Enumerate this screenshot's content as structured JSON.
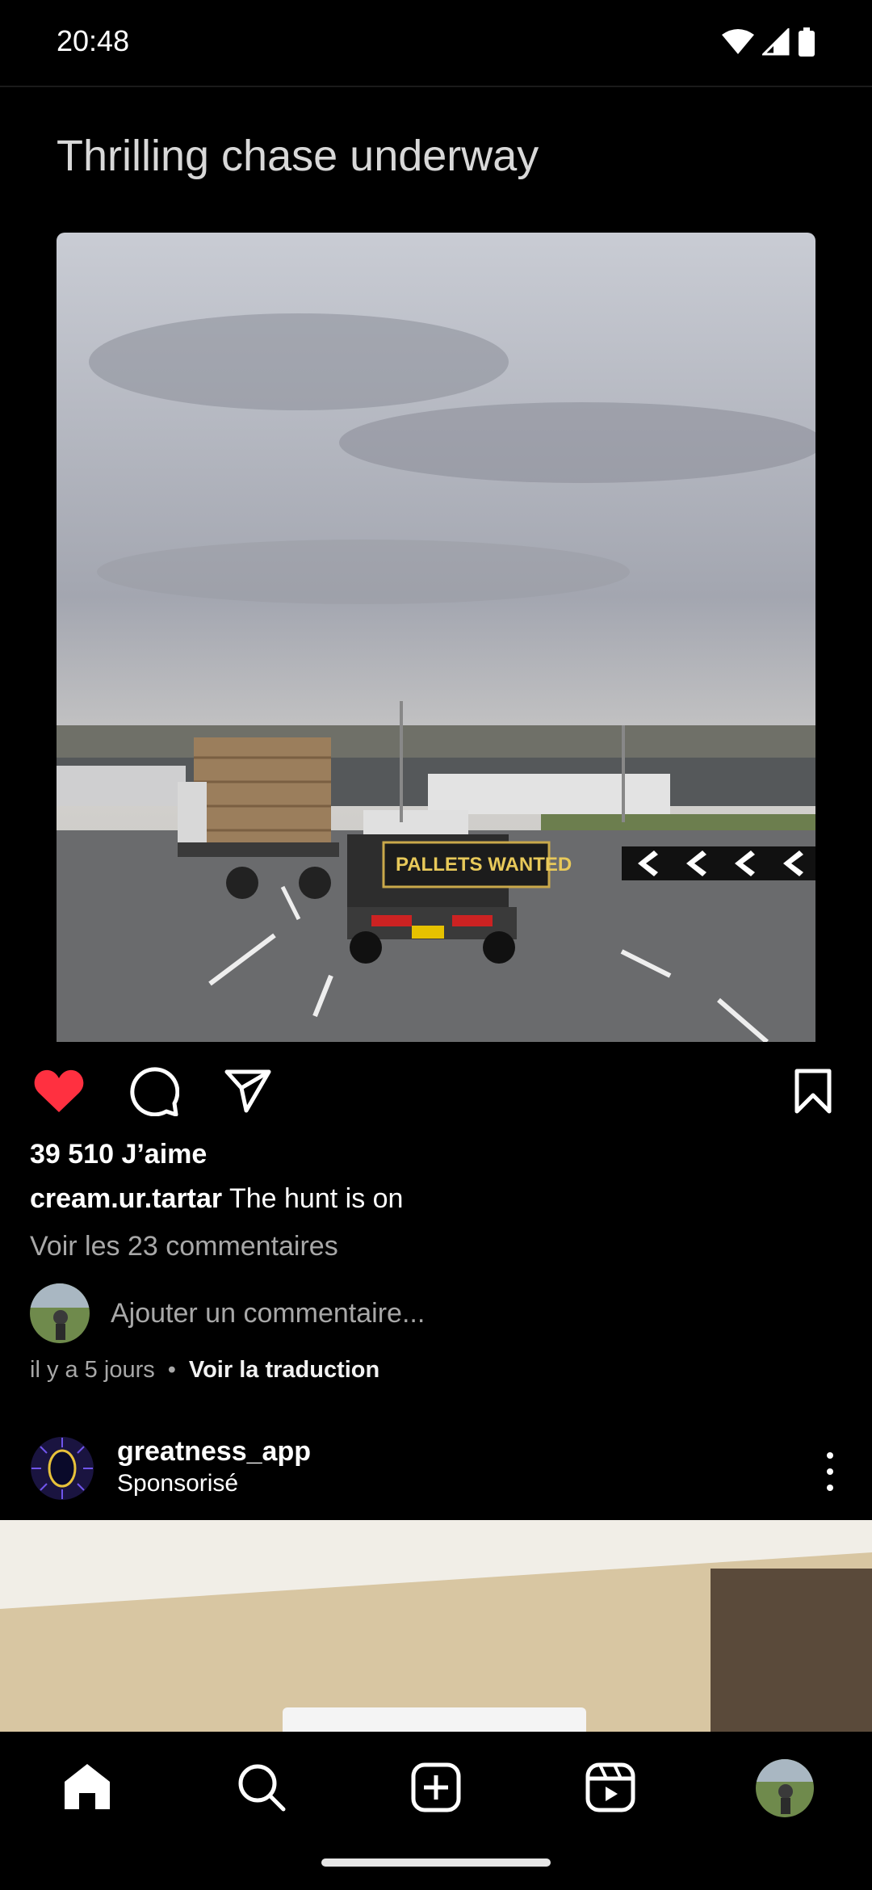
{
  "status_bar": {
    "time": "20:48"
  },
  "post": {
    "meme_title": "Thrilling chase underway",
    "photo_sign_text": "PALLETS WANTED",
    "likes": "39 510 J’aime",
    "caption_user": "cream.ur.tartar",
    "caption_text": "The hunt is on",
    "view_comments": "Voir les 23 commentaires",
    "comment_placeholder": "Ajouter un commentaire...",
    "time_ago": "il y a 5 jours",
    "separator": "•",
    "translate_label": "Voir la traduction",
    "liked": true
  },
  "sponsored_post": {
    "username": "greatness_app",
    "sponsored_label": "Sponsorisé"
  },
  "icons": {
    "like": "heart-icon",
    "comment": "comment-icon",
    "share": "send-icon",
    "save": "bookmark-icon",
    "home": "home-icon",
    "search": "search-icon",
    "create": "add-icon",
    "reels": "reels-icon"
  },
  "colors": {
    "background": "#000000",
    "like_red": "#ff3040",
    "secondary_text": "#a8a8a8"
  }
}
